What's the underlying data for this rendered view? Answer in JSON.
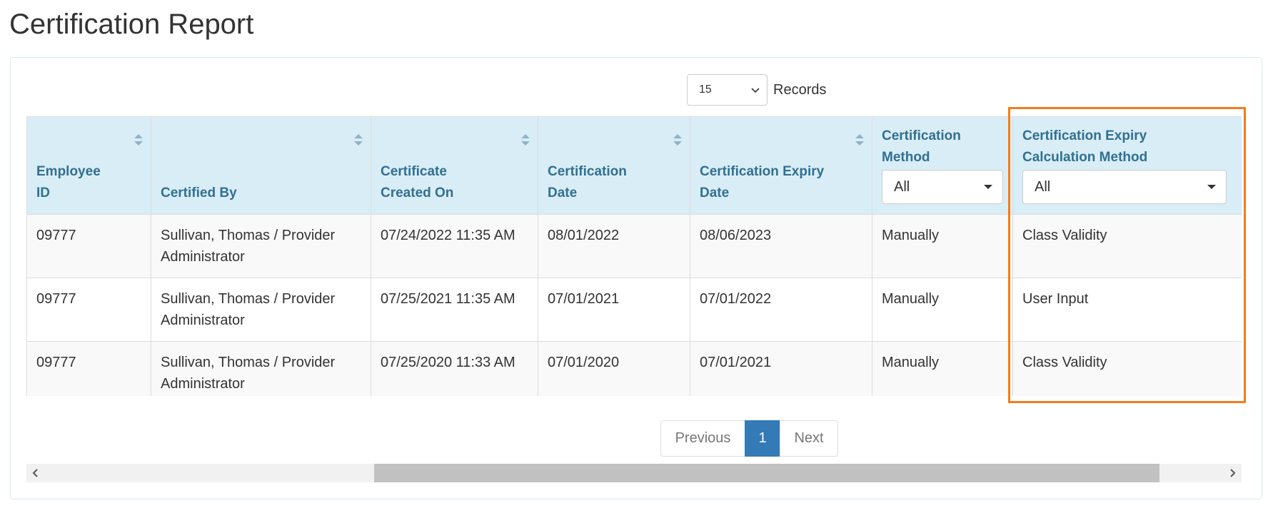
{
  "page": {
    "title": "Certification Report"
  },
  "records": {
    "value": "15",
    "label": "Records"
  },
  "table": {
    "headers": {
      "employee_id": "Employee ID",
      "certified_by": "Certified By",
      "created_on": "Certificate Created On",
      "cert_date": "Certification Date",
      "expiry_date": "Certification Expiry Date",
      "method": "Certification Method",
      "expiry_method": "Certification Expiry Calculation Method"
    },
    "filters": {
      "method": "All",
      "expiry_method": "All"
    },
    "rows": [
      {
        "employee_id": "09777",
        "certified_by": "Sullivan, Thomas / Provider Administrator",
        "created_on": "07/24/2022 11:35 AM",
        "cert_date": "08/01/2022",
        "expiry_date": "08/06/2023",
        "method": "Manually",
        "expiry_method": "Class Validity"
      },
      {
        "employee_id": "09777",
        "certified_by": "Sullivan, Thomas / Provider Administrator",
        "created_on": "07/25/2021 11:35 AM",
        "cert_date": "07/01/2021",
        "expiry_date": "07/01/2022",
        "method": "Manually",
        "expiry_method": "User Input"
      },
      {
        "employee_id": "09777",
        "certified_by": "Sullivan, Thomas / Provider Administrator",
        "created_on": "07/25/2020 11:33 AM",
        "cert_date": "07/01/2020",
        "expiry_date": "07/01/2021",
        "method": "Manually",
        "expiry_method": "Class Validity"
      }
    ]
  },
  "pagination": {
    "previous": "Previous",
    "current": "1",
    "next": "Next"
  },
  "colors": {
    "header_bg": "#d9edf7",
    "header_text": "#31708f",
    "highlight": "#f07d1e",
    "pager_active": "#337ab7"
  }
}
